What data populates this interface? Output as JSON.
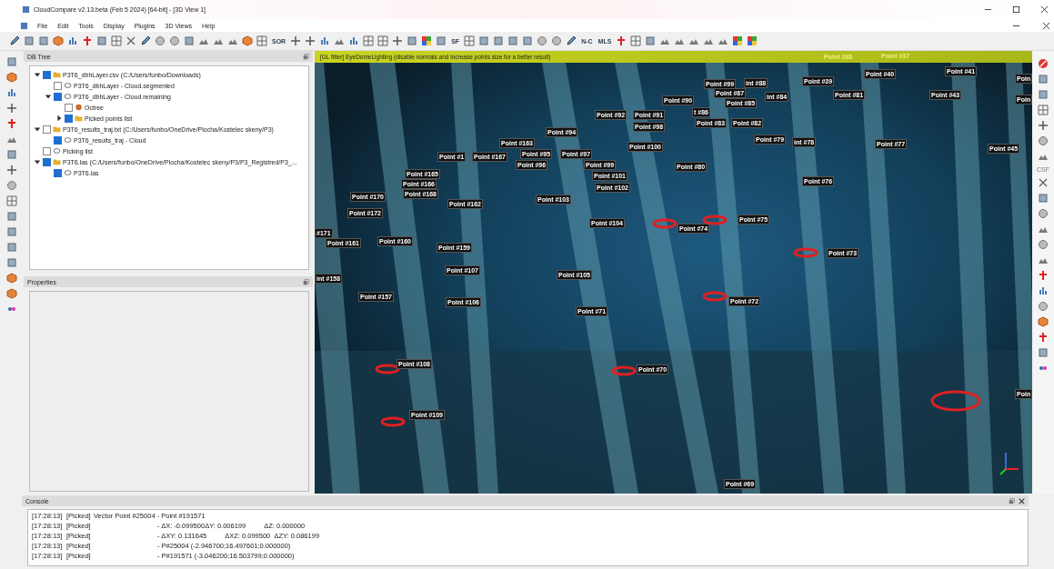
{
  "window": {
    "title": "CloudCompare v2.13.beta (Feb 5 2024) [64-bit] - [3D View 1]"
  },
  "menu": [
    "File",
    "Edit",
    "Tools",
    "Display",
    "Plugins",
    "3D Views",
    "Help"
  ],
  "toolbar": {
    "text_buttons": [
      "SOR",
      "SF",
      "N-C",
      "MLS"
    ]
  },
  "db_tree": {
    "title": "DB Tree",
    "items": [
      {
        "label": "P3T6_dbhLayer.csv (C:/Users/funbo/Downloads)",
        "kind": "folder",
        "checked": true,
        "expanded": true,
        "children": [
          {
            "label": "P3T6_dbhLayer - Cloud.segmented",
            "kind": "cloud",
            "checked": false
          },
          {
            "label": "P3T6_dbhLayer - Cloud.remaining",
            "kind": "cloud",
            "checked": true,
            "expanded": true,
            "children": [
              {
                "label": "Octree",
                "kind": "octree",
                "checked": false
              },
              {
                "label": "Picked points list",
                "kind": "folder",
                "checked": true,
                "expanded": false
              }
            ]
          }
        ]
      },
      {
        "label": "P3T6_results_traj.txt (C:/Users/funbo/OneDrive/Plocha/Kostelec skeny/P3)",
        "kind": "folder",
        "checked": false,
        "expanded": true,
        "children": [
          {
            "label": "P3T6_results_traj - Cloud",
            "kind": "cloud",
            "checked": true
          }
        ]
      },
      {
        "label": "Picking list",
        "kind": "cloud",
        "checked": false
      },
      {
        "label": "P3T6.las (C:/Users/funbo/OneDrive/Plocha/Kostelec skeny/P3/P3_Registred/P3_...",
        "kind": "folder",
        "checked": true,
        "expanded": true,
        "children": [
          {
            "label": "P3T6.las",
            "kind": "cloud",
            "checked": true
          }
        ]
      }
    ]
  },
  "properties": {
    "title": "Properties"
  },
  "view": {
    "banner": "[GL filter] EyeDomeLighting (disable normals and increase points size for a better result)",
    "point_labels": [
      "Point #38",
      "Point #37",
      "Point #40",
      "Point #41",
      "Point #39",
      "Point #99",
      "int #88",
      "Point #87",
      "Point #85",
      "int #84",
      "Point #90",
      "t #86",
      "Point #81",
      "Point #43",
      "Point #92",
      "Point #91",
      "Point #83",
      "Point #82",
      "Point #98",
      "Point #94",
      "Point #163",
      "Point #95",
      "Point #97",
      "Point #100",
      "Point #79",
      "int #78",
      "Point #77",
      "Point #45",
      "Point #1",
      "Point #167",
      "Point #96",
      "Point #99",
      "Point #101",
      "Point #80",
      "Point #165",
      "Point #166",
      "Point #102",
      "Point #76",
      "Point #168",
      "Point #170",
      "Point #103",
      "Point #162",
      "Point #172",
      "Point #75",
      "Point #104",
      "Point #74",
      "#171",
      "Point #161",
      "Point #160",
      "Point #159",
      "Point #73",
      "Point #107",
      "Point #105",
      "int #158",
      "Point #157",
      "Point #72",
      "Point #106",
      "Point #71",
      "Point #108",
      "Point #70",
      "Point #109",
      "Point #69",
      "Poin",
      "Poin",
      "Poin"
    ]
  },
  "right_toolbar": {
    "label": "CSF"
  },
  "console": {
    "title": "Console",
    "lines": [
      {
        "time": "[17:28:13]",
        "tag": "[Picked]",
        "kind": "inline",
        "parts": [
          "Vector Point #25004 - Point #191571"
        ]
      },
      {
        "time": "[17:28:13]",
        "tag": "[Picked]",
        "kind": "column",
        "parts": [
          "- ΔX: -0.099500ΔY: 0.006199",
          "ΔZ: 0.000000"
        ]
      },
      {
        "time": "[17:28:13]",
        "tag": "[Picked]",
        "kind": "column",
        "parts": [
          "- ΔXY: 0.131645",
          "ΔXZ: 0.099500  ΔZY: 0.086199"
        ]
      },
      {
        "time": "[17:28:13]",
        "tag": "[Picked]",
        "kind": "column",
        "parts": [
          "- P#25004 (-2.946700;16.497601;0.000000)"
        ]
      },
      {
        "time": "[17:28:13]",
        "tag": "[Picked]",
        "kind": "column",
        "parts": [
          "- P#191571 (-3.046200;16.503799;0.000000)"
        ]
      }
    ]
  }
}
